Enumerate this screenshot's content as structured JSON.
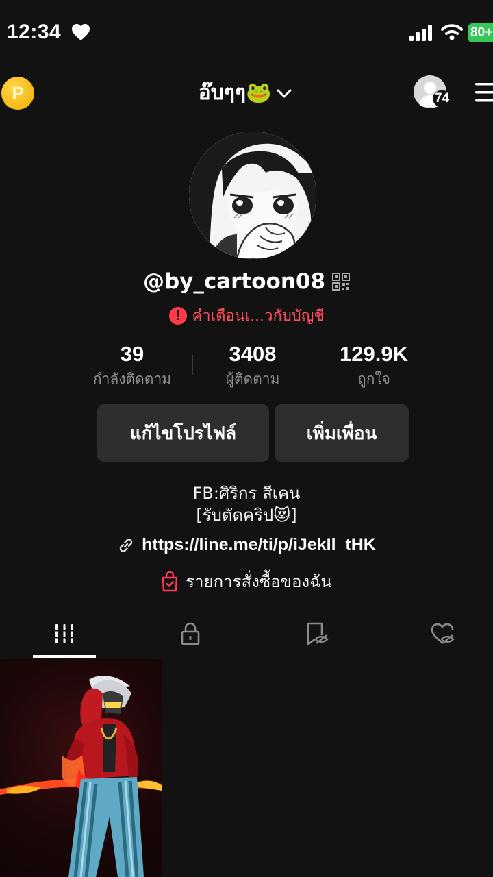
{
  "status_bar": {
    "time": "12:34",
    "battery_percent": "80+",
    "battery_color": "#35c759",
    "icons": [
      "heart-icon",
      "signal-icon",
      "wifi-icon"
    ]
  },
  "header": {
    "coin_label": "P",
    "account_name": "อ๊บๆๆ🐸",
    "friends_badge": "74",
    "icons": [
      "coin-icon",
      "chevron-down-icon",
      "menu-icon"
    ]
  },
  "profile": {
    "username": "@by_cartoon08",
    "warning": "คำเตือนเ...วกับบัญชี",
    "warning_color": "#ff4d5b"
  },
  "stats": {
    "following": {
      "value": "39",
      "label": "กำลังติดตาม"
    },
    "followers": {
      "value": "3408",
      "label": "ผู้ติดตาม"
    },
    "likes": {
      "value": "129.9K",
      "label": "ถูกใจ"
    }
  },
  "buttons": {
    "edit_profile": "แก้ไขโปรไฟล์",
    "add_friend": "เพิ่มเพื่อน"
  },
  "bio": {
    "line1": "FB:ศิริกร  สีเคน",
    "line2": "[รับตัดคริป😻]",
    "link": "https://line.me/ti/p/iJekIl_tHK",
    "orders": "รายการสั่งซื้อของฉัน",
    "orders_icon_color": "#ff3b5c"
  },
  "tabs": {
    "active": "videos",
    "items": [
      "videos-grid-icon",
      "lock-icon",
      "bookmark-hidden-icon",
      "heart-hidden-icon"
    ]
  },
  "videos": {
    "count_shown": 1
  }
}
